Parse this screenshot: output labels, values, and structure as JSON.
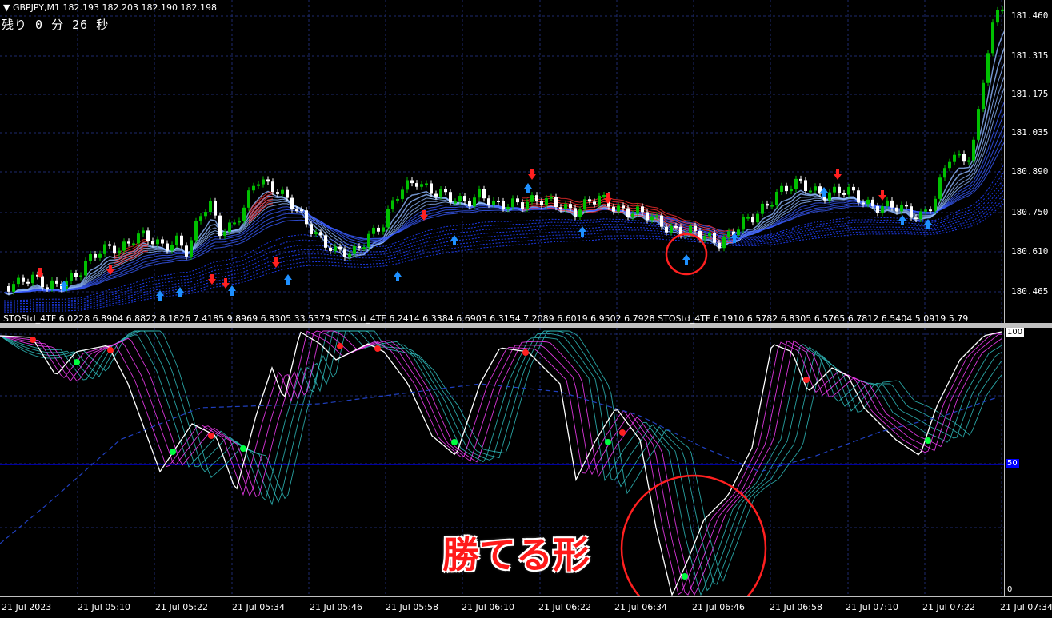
{
  "header": {
    "symbol": "GBPJPY,M1",
    "ohlc": "182.193 182.203 182.190 182.198",
    "timer": "残り 0 分 26 秒"
  },
  "indicator": {
    "label": "STOStd_4TF 6.0228 6.8904 6.8822 8.1826 7.4185 9.8969 6.8305 33.5379  STOStd_4TF 6.2414 6.3384 6.6903 6.3154 7.2089 6.6019 6.9502 6.7928  STOStd_4TF 6.1910 6.5782 6.8305 6.5765 6.7812 6.5404 5.0919 5.79",
    "level_100": "100",
    "level_50": "50",
    "level_0": "0"
  },
  "price_axis": {
    "labels": [
      "181.460",
      "181.315",
      "181.175",
      "181.035",
      "180.890",
      "180.750",
      "180.610",
      "180.465"
    ]
  },
  "time_axis": {
    "labels": [
      "21 Jul 2023",
      "21 Jul 05:10",
      "21 Jul 05:22",
      "21 Jul 05:34",
      "21 Jul 05:46",
      "21 Jul 05:58",
      "21 Jul 06:10",
      "21 Jul 06:22",
      "21 Jul 06:34",
      "21 Jul 06:46",
      "21 Jul 06:58",
      "21 Jul 07:10",
      "21 Jul 07:22",
      "21 Jul 07:34"
    ]
  },
  "annotation": {
    "text": "勝てる形"
  },
  "colors": {
    "bull": "#00c000",
    "bear": "#ffffff",
    "grid": "#1e2a6e",
    "buy_arrow": "#1e90ff",
    "sell_arrow": "#ff2020",
    "circle": "#ff2020"
  }
}
